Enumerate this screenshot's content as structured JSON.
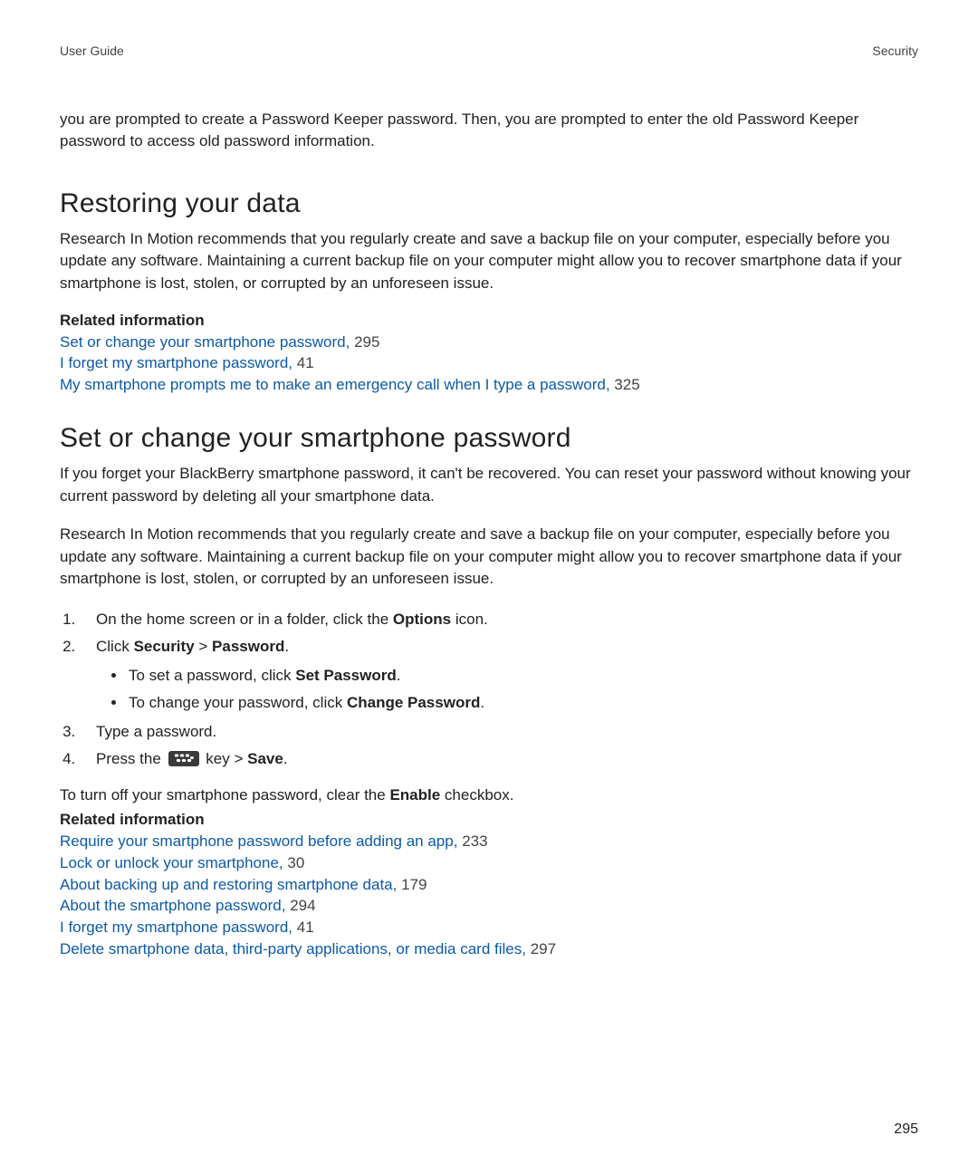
{
  "header": {
    "left": "User Guide",
    "right": "Security"
  },
  "intro": "you are prompted to create a Password Keeper password. Then, you are prompted to enter the old Password Keeper password to access old password information.",
  "section1": {
    "title": "Restoring your data",
    "body": "Research In Motion recommends that you regularly create and save a backup file on your computer, especially before you update any software. Maintaining a current backup file on your computer might allow you to recover smartphone data if your smartphone is lost, stolen, or corrupted by an unforeseen issue.",
    "related_label": "Related information",
    "related": [
      {
        "text": "Set or change your smartphone password,",
        "page": "295"
      },
      {
        "text": "I forget my smartphone password,",
        "page": "41"
      },
      {
        "text": "My smartphone prompts me to make an emergency call when I type a password,",
        "page": "325"
      }
    ]
  },
  "section2": {
    "title": "Set or change your smartphone password",
    "para1": "If you forget your BlackBerry smartphone password, it can't be recovered. You can reset your password without knowing your current password by deleting all your smartphone data.",
    "para2": "Research In Motion recommends that you regularly create and save a backup file on your computer, especially before you update any software. Maintaining a current backup file on your computer might allow you to recover smartphone data if your smartphone is lost, stolen, or corrupted by an unforeseen issue.",
    "step1_a": "On the home screen or in a folder, click the ",
    "step1_bold": "Options",
    "step1_b": " icon.",
    "step2_a": "Click ",
    "step2_bold1": "Security",
    "step2_sep": " > ",
    "step2_bold2": "Password",
    "step2_end": ".",
    "bullet1_a": "To set a password, click ",
    "bullet1_bold": "Set Password",
    "bullet1_end": ".",
    "bullet2_a": "To change your password, click ",
    "bullet2_bold": "Change Password",
    "bullet2_end": ".",
    "step3": "Type a password.",
    "step4_a": "Press the ",
    "step4_b": " key > ",
    "step4_bold": "Save",
    "step4_end": ".",
    "turnoff_a": "To turn off your smartphone password, clear the ",
    "turnoff_bold": "Enable",
    "turnoff_b": " checkbox.",
    "related_label": "Related information",
    "related": [
      {
        "text": "Require your smartphone password before adding an app,",
        "page": "233"
      },
      {
        "text": "Lock or unlock your smartphone,",
        "page": "30"
      },
      {
        "text": "About backing up and restoring smartphone data,",
        "page": "179"
      },
      {
        "text": "About the smartphone password,",
        "page": "294"
      },
      {
        "text": "I forget my smartphone password,",
        "page": "41"
      },
      {
        "text": "Delete smartphone data, third-party applications, or media card files,",
        "page": "297"
      }
    ]
  },
  "page_number": "295"
}
